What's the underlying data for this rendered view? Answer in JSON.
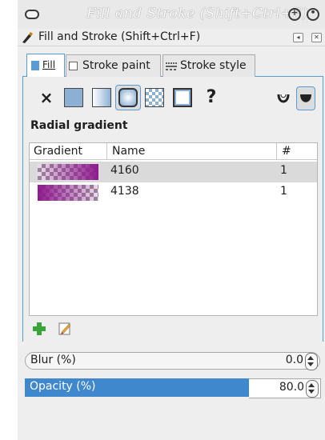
{
  "window": {
    "title": "Fill and Stroke (Shift+Ctrl+F)"
  },
  "dock": {
    "title": "Fill and Stroke (Shift+Ctrl+F)"
  },
  "tabs": [
    {
      "label": "Fill",
      "active": true
    },
    {
      "label": "Stroke paint",
      "active": false
    },
    {
      "label": "Stroke style",
      "active": false
    }
  ],
  "paint_modes": [
    "no-paint",
    "flat-color",
    "linear-gradient",
    "radial-gradient",
    "pattern",
    "swatch",
    "unset"
  ],
  "selected_paint_mode": "radial-gradient",
  "unset_label": "?",
  "heading": "Radial gradient",
  "gradient_list": {
    "columns": [
      "Gradient",
      "Name",
      "#"
    ],
    "rows": [
      {
        "name": "4160",
        "count": "1",
        "selected": true,
        "color": "#8e1a8e"
      },
      {
        "name": "4138",
        "count": "1",
        "selected": false,
        "color": "#8e1a8e"
      }
    ]
  },
  "blur": {
    "label": "Blur (%)",
    "value": "0.0"
  },
  "opacity": {
    "label": "Opacity (%)",
    "value": "80.0",
    "level_percent": 80
  },
  "colors": {
    "accent": "#3f88cd",
    "gradient": "#8e1a8e"
  }
}
